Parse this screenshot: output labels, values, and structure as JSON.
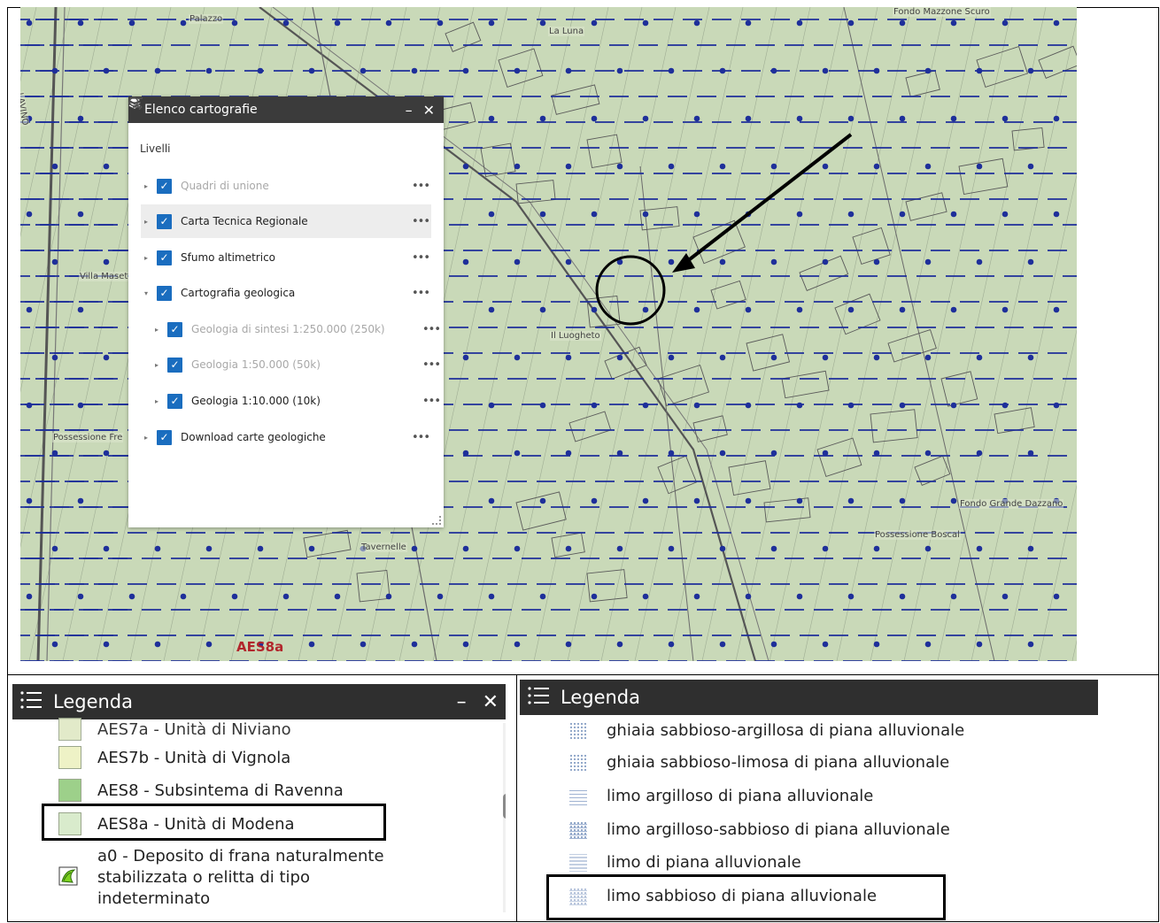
{
  "map": {
    "place_labels": [
      "Palazzo",
      "La Luna",
      "Fondo Mazzone Scuro",
      "Villa Masetti",
      "Il Luogheto",
      "Possessione Fre",
      "Fondo Grande Dazzano",
      "Possessione Boscal",
      "Tavernelle",
      "LAVINO"
    ],
    "unit_code": "AES8a",
    "colors": {
      "map_bg": "#c9d9b8",
      "hatch_blue": "#1e2f9a",
      "annotation": "#000000"
    }
  },
  "layer_panel": {
    "title": "Elenco cartografie",
    "minimize": "–",
    "close": "✕",
    "section_label": "Livelli",
    "icons": {
      "panel": "layers-icon",
      "search": "search-icon",
      "filter": "filter-icon",
      "more": "more-icon",
      "expand": "expand-icon"
    },
    "layers": [
      {
        "label": "Quadri di unione",
        "checked": true,
        "dim": true
      },
      {
        "label": "Carta Tecnica Regionale",
        "checked": true,
        "dim": false
      },
      {
        "label": "Sfumo altimetrico",
        "checked": true,
        "dim": false
      },
      {
        "label": "Cartografia geologica",
        "checked": true,
        "dim": false,
        "expanded": true
      },
      {
        "label": "Geologia di sintesi 1:250.000 (250k)",
        "checked": true,
        "dim": true
      },
      {
        "label": "Geologia 1:50.000 (50k)",
        "checked": true,
        "dim": true
      },
      {
        "label": "Geologia 1:10.000 (10k)",
        "checked": true,
        "dim": false
      },
      {
        "label": "Download carte geologiche",
        "checked": true,
        "dim": false
      }
    ],
    "more_glyph": "•••"
  },
  "legend_left": {
    "title": "Legenda",
    "minimize": "–",
    "close": "✕",
    "items": [
      {
        "label": "AES7a - Unità di Niviano",
        "color": "#dfe8c4",
        "cut": true
      },
      {
        "label": "AES7b - Unità di Vignola",
        "color": "#eef2c6"
      },
      {
        "label": "AES8 - Subsintema di Ravenna",
        "color": "#9dd08a"
      },
      {
        "label": "AES8a - Unità di Modena",
        "color": "#d9ebcc",
        "highlighted": true
      },
      {
        "label_lines": [
          "a0 - Deposito di frana naturalmente",
          "stabilizzata o relitta di tipo",
          "indeterminato"
        ],
        "icon": "landslide-icon"
      }
    ]
  },
  "legend_right": {
    "title": "Legenda",
    "items": [
      {
        "label": "ghiaia sabbioso-argillosa di piana alluvionale",
        "cut": true
      },
      {
        "label": "ghiaia sabbioso-limosa di piana alluvionale"
      },
      {
        "label": "limo argilloso di piana alluvionale"
      },
      {
        "label": "limo argilloso-sabbioso di piana alluvionale"
      },
      {
        "label": "limo di piana alluvionale"
      },
      {
        "label": "limo sabbioso di piana alluvionale",
        "highlighted": true
      }
    ]
  }
}
